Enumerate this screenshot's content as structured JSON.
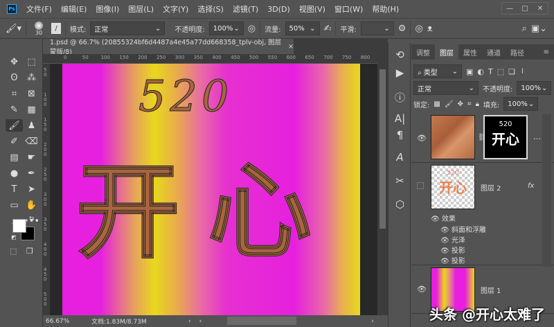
{
  "menu": {
    "logo": "Ps",
    "items": [
      "文件(F)",
      "编辑(E)",
      "图像(I)",
      "图层(L)",
      "文字(Y)",
      "选择(S)",
      "滤镜(T)",
      "3D(D)",
      "视图(V)",
      "窗口(W)",
      "帮助(H)"
    ],
    "minimize": "—",
    "maximize": "□",
    "close": "✕"
  },
  "options": {
    "brush_size": "30",
    "mode_label": "模式:",
    "mode_value": "正常",
    "opacity_label": "不透明度:",
    "opacity_value": "100%",
    "flow_label": "流量:",
    "flow_value": "50%",
    "smooth_label": "平滑:",
    "smooth_value": ""
  },
  "document": {
    "tab_title": "1.psd @ 66.7% (20855324bf6d4487a4e45a77dd668358_tplv-obj, 图层蒙版/8)",
    "close": "×",
    "zoom": "66.67%",
    "doc_info": "文档:1.83M/8.73M",
    "ruler_top": [
      "0",
      "50",
      "100",
      "150",
      "200",
      "250",
      "300",
      "350",
      "400",
      "450",
      "500",
      "550",
      "600",
      "650",
      "700",
      "750",
      "800"
    ],
    "ruler_left": [
      "50",
      "100",
      "150",
      "200",
      "250",
      "300",
      "350",
      "400",
      "450",
      "500"
    ],
    "canvas_text_top": "520",
    "canvas_text_main": "开心"
  },
  "colors": {
    "magenta": "#e620de",
    "yellow": "#e8d81c",
    "brown": "#a8653e"
  },
  "panel": {
    "tabs": [
      "调整",
      "图层",
      "属性",
      "通道",
      "路径"
    ],
    "active_tab": "图层",
    "filter_kind": "类型",
    "blend_mode": "正常",
    "opacity_label": "不透明度:",
    "opacity_value": "100%",
    "lock_label": "锁定:",
    "fill_label": "填充:",
    "fill_value": "100%",
    "layers": [
      {
        "name": "",
        "mask_text_top": "520",
        "mask_text_main": "开心"
      },
      {
        "name": "图层 2",
        "thumb_text_top": "520",
        "thumb_text_main": "开心",
        "fx": "fx",
        "effects_label": "效果",
        "effects": [
          "斜面和浮雕",
          "光泽",
          "投影",
          "投影"
        ]
      },
      {
        "name": "图层 1"
      }
    ]
  },
  "watermark": "头条 @开心太难了"
}
